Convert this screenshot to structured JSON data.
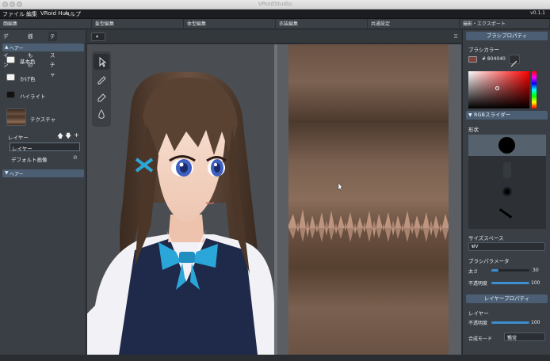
{
  "window": {
    "title": "VRoidStudio",
    "version": "v0.1.1"
  },
  "menu": [
    "ファイル",
    "編集",
    "VRoid Hub",
    "ヘルプ"
  ],
  "mode_tabs": [
    "顔編集",
    "髪型編集",
    "体型編集",
    "衣装編集",
    "共通設定",
    "撮影・エクスポート"
  ],
  "left": {
    "tabs": [
      "デザイン",
      "揺れもの",
      "テクスチャ"
    ],
    "section1": "ヘアー",
    "colors": [
      {
        "label": "基本色",
        "color": "#f4f4f4"
      },
      {
        "label": "かげ色",
        "color": "#f4f4f4"
      },
      {
        "label": "ハイライト",
        "color": "#111111"
      }
    ],
    "texture_label": "テクスチャ",
    "layer_label": "レイヤー",
    "layer_name": "レイヤー",
    "default_image": "デフォルト画像",
    "section2": "ヘアー"
  },
  "right": {
    "brush_props": "ブラシプロパティ",
    "brush_color": "ブラシカラー",
    "hex": "# 804040",
    "swatch": "#804040",
    "rgb_slider": "RGBスライダー",
    "shape": "形状",
    "size_space": "サイズスペース",
    "size_space_value": "UV",
    "brush_params": "ブラシパラメータ",
    "thickness_label": "太さ",
    "thickness_value": "30",
    "thickness": 0.18,
    "opacity_label": "不透明度",
    "opacity_value": "100",
    "opacity": 1.0,
    "layer_props": "レイヤープロパティ",
    "layer": "レイヤー",
    "layer_opacity_label": "不透明度",
    "layer_opacity_value": "100",
    "layer_opacity": 1.0,
    "blend_label": "合成モード",
    "blend_value": "通常"
  },
  "viewport": {
    "view_select_icon": "chevron-down-icon",
    "tools": [
      "cursor-icon",
      "pen-icon",
      "eraser-icon",
      "fill-icon"
    ]
  }
}
